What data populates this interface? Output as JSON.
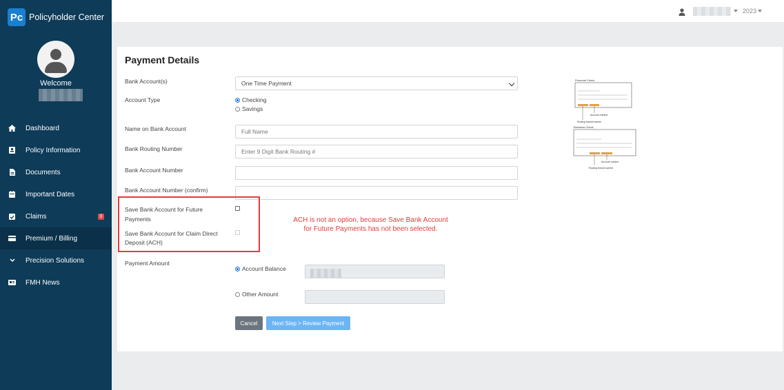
{
  "app": {
    "logo_text": "Pc",
    "name": "Policyholder Center"
  },
  "sidebar": {
    "welcome": "Welcome",
    "items": [
      {
        "label": "Dashboard",
        "icon": "home-icon"
      },
      {
        "label": "Policy Information",
        "icon": "policy-icon"
      },
      {
        "label": "Documents",
        "icon": "document-icon"
      },
      {
        "label": "Important Dates",
        "icon": "calendar-icon"
      },
      {
        "label": "Claims",
        "icon": "clipboard-icon",
        "badge": "0"
      },
      {
        "label": "Premium / Billing",
        "icon": "billing-icon",
        "active": true
      },
      {
        "label": "Precision Solutions",
        "icon": "chevron-down-icon"
      },
      {
        "label": "FMH News",
        "icon": "news-icon"
      }
    ]
  },
  "topbar": {
    "year": "2023"
  },
  "form": {
    "title": "Payment Details",
    "bank_accounts_label": "Bank Account(s)",
    "bank_accounts_value": "One Time Payment",
    "account_type_label": "Account Type",
    "account_type_options": [
      "Checking",
      "Savings"
    ],
    "account_type_selected": "Checking",
    "name_label": "Name on Bank Account",
    "name_placeholder": "Full Name",
    "routing_label": "Bank Routing Number",
    "routing_placeholder": "Enter 9 Digit Bank Routing #",
    "account_number_label": "Bank Account Number",
    "account_number_confirm_label": "Bank Account Number (confirm)",
    "save_future_label_1": "Save Bank Account for Future",
    "save_future_label_2": "Payments",
    "save_ach_label_1": "Save Bank Account for Claim Direct",
    "save_ach_label_2": "Deposit (ACH)",
    "payment_amount_label": "Payment Amount",
    "account_balance_label": "Account Balance",
    "other_amount_label": "Other Amount",
    "cancel_label": "Cancel",
    "next_label": "Next Step > Review Payment"
  },
  "annotation": {
    "line1": "ACH is not an option, because Save Bank Account",
    "line2": "for Future Payments has not been selected."
  },
  "check_diagram": {
    "personal_title": "Personal Check",
    "business_title": "Business Check",
    "account_number": "Account number",
    "routing_number": "Routing transit number"
  },
  "colors": {
    "sidebar": "#0d3b58",
    "accent": "#1a73d9",
    "annotation": "#e53a3a",
    "next_button": "#6cb5f5"
  }
}
